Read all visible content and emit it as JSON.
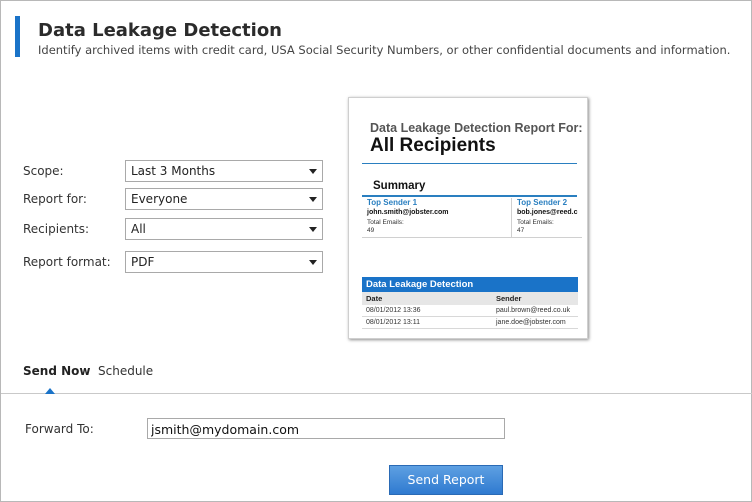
{
  "header": {
    "title": "Data Leakage Detection",
    "subtitle": "Identify archived items with credit card, USA Social Security Numbers, or other confidential documents and information.",
    "accent_color": "#1a73c8"
  },
  "form": {
    "scope": {
      "label": "Scope:",
      "value": "Last 3 Months"
    },
    "report_for": {
      "label": "Report for:",
      "value": "Everyone"
    },
    "recipients": {
      "label": "Recipients:",
      "value": "All"
    },
    "report_format": {
      "label": "Report format:",
      "value": "PDF"
    }
  },
  "preview": {
    "report_for_title": "Data Leakage Detection Report For:",
    "big_title": "All Recipients",
    "summary_label": "Summary",
    "top_senders": [
      {
        "heading": "Top Sender 1",
        "email": "john.smith@jobster.com",
        "total_label": "Total Emails:",
        "total": "49"
      },
      {
        "heading": "Top Sender 2",
        "email": "bob.jones@reed.c",
        "total_label": "Total Emails:",
        "total": "47"
      }
    ],
    "table_title": "Data Leakage Detection",
    "columns": [
      "Date",
      "Sender"
    ],
    "rows": [
      {
        "date": "08/01/2012 13:36",
        "sender": "paul.brown@reed.co.uk"
      },
      {
        "date": "08/01/2012 13:11",
        "sender": "jane.doe@jobster.com"
      }
    ]
  },
  "tabs": [
    {
      "label": "Send Now",
      "active": true
    },
    {
      "label": "Schedule",
      "active": false
    }
  ],
  "forward": {
    "label": "Forward To:",
    "value": "jsmith@mydomain.com"
  },
  "send_button": {
    "label": "Send Report"
  }
}
